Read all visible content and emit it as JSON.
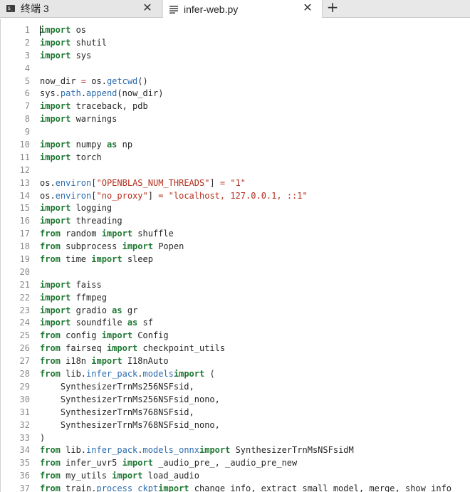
{
  "tabs": [
    {
      "label": "终端 3",
      "icon": "terminal-icon",
      "close": "✕"
    },
    {
      "label": "infer-web.py",
      "icon": "document-icon",
      "close": "✕"
    }
  ],
  "new_tab": "+",
  "colors": {
    "keyword": "#1e7832",
    "function": "#2b6cb0",
    "string": "#b5301e",
    "text": "#262626",
    "line_number": "#8a8a8a"
  },
  "code_lines": [
    {
      "n": "1",
      "tokens": [
        [
          "kw",
          "import"
        ],
        [
          "",
          "os"
        ]
      ]
    },
    {
      "n": "2",
      "tokens": [
        [
          "kw",
          "import"
        ],
        [
          "",
          "shutil"
        ]
      ]
    },
    {
      "n": "3",
      "tokens": [
        [
          "kw",
          "import"
        ],
        [
          "",
          "sys"
        ]
      ]
    },
    {
      "n": "4",
      "tokens": []
    },
    {
      "n": "5",
      "tokens": [
        [
          "",
          "now_dir "
        ],
        [
          "op",
          "="
        ],
        [
          "",
          "os."
        ],
        [
          "fn",
          "getcwd"
        ],
        [
          "",
          "()"
        ]
      ]
    },
    {
      "n": "6",
      "tokens": [
        [
          "",
          "sys."
        ],
        [
          "fn",
          "path"
        ],
        [
          "",
          "."
        ],
        [
          "fn",
          "append"
        ],
        [
          "",
          "(now_dir)"
        ]
      ]
    },
    {
      "n": "7",
      "tokens": [
        [
          "kw",
          "import"
        ],
        [
          "",
          "traceback, pdb"
        ]
      ]
    },
    {
      "n": "8",
      "tokens": [
        [
          "kw",
          "import"
        ],
        [
          "",
          "warnings"
        ]
      ]
    },
    {
      "n": "9",
      "tokens": []
    },
    {
      "n": "10",
      "tokens": [
        [
          "kw",
          "import"
        ],
        [
          "",
          "numpy "
        ],
        [
          "kw",
          "as"
        ],
        [
          "",
          "np"
        ]
      ]
    },
    {
      "n": "11",
      "tokens": [
        [
          "kw",
          "import"
        ],
        [
          "",
          "torch"
        ]
      ]
    },
    {
      "n": "12",
      "tokens": []
    },
    {
      "n": "13",
      "tokens": [
        [
          "",
          "os."
        ],
        [
          "fn",
          "environ"
        ],
        [
          "",
          "["
        ],
        [
          "st",
          "\"OPENBLAS_NUM_THREADS\""
        ],
        [
          "",
          "] "
        ],
        [
          "op",
          "="
        ],
        [
          "st",
          "\"1\""
        ]
      ]
    },
    {
      "n": "14",
      "tokens": [
        [
          "",
          "os."
        ],
        [
          "fn",
          "environ"
        ],
        [
          "",
          "["
        ],
        [
          "st",
          "\"no_proxy\""
        ],
        [
          "",
          "] "
        ],
        [
          "op",
          "="
        ],
        [
          "st",
          "\"localhost, 127.0.0.1, ::1\""
        ]
      ]
    },
    {
      "n": "15",
      "tokens": [
        [
          "kw",
          "import"
        ],
        [
          "",
          "logging"
        ]
      ]
    },
    {
      "n": "16",
      "tokens": [
        [
          "kw",
          "import"
        ],
        [
          "",
          "threading"
        ]
      ]
    },
    {
      "n": "17",
      "tokens": [
        [
          "kw",
          "from"
        ],
        [
          "",
          "random "
        ],
        [
          "kw",
          "import"
        ],
        [
          "",
          "shuffle"
        ]
      ]
    },
    {
      "n": "18",
      "tokens": [
        [
          "kw",
          "from"
        ],
        [
          "",
          "subprocess "
        ],
        [
          "kw",
          "import"
        ],
        [
          "",
          "Popen"
        ]
      ]
    },
    {
      "n": "19",
      "tokens": [
        [
          "kw",
          "from"
        ],
        [
          "",
          "time "
        ],
        [
          "kw",
          "import"
        ],
        [
          "",
          "sleep"
        ]
      ]
    },
    {
      "n": "20",
      "tokens": []
    },
    {
      "n": "21",
      "tokens": [
        [
          "kw",
          "import"
        ],
        [
          "",
          "faiss"
        ]
      ]
    },
    {
      "n": "22",
      "tokens": [
        [
          "kw",
          "import"
        ],
        [
          "",
          "ffmpeg"
        ]
      ]
    },
    {
      "n": "23",
      "tokens": [
        [
          "kw",
          "import"
        ],
        [
          "",
          "gradio "
        ],
        [
          "kw",
          "as"
        ],
        [
          "",
          "gr"
        ]
      ]
    },
    {
      "n": "24",
      "tokens": [
        [
          "kw",
          "import"
        ],
        [
          "",
          "soundfile "
        ],
        [
          "kw",
          "as"
        ],
        [
          "",
          "sf"
        ]
      ]
    },
    {
      "n": "25",
      "tokens": [
        [
          "kw",
          "from"
        ],
        [
          "",
          "config "
        ],
        [
          "kw",
          "import"
        ],
        [
          "",
          "Config"
        ]
      ]
    },
    {
      "n": "26",
      "tokens": [
        [
          "kw",
          "from"
        ],
        [
          "",
          "fairseq "
        ],
        [
          "kw",
          "import"
        ],
        [
          "",
          "checkpoint_utils"
        ]
      ]
    },
    {
      "n": "27",
      "tokens": [
        [
          "kw",
          "from"
        ],
        [
          "",
          "i18n "
        ],
        [
          "kw",
          "import"
        ],
        [
          "",
          "I18nAuto"
        ]
      ]
    },
    {
      "n": "28",
      "tokens": [
        [
          "kw",
          "from"
        ],
        [
          "",
          "lib."
        ],
        [
          "fn",
          "infer_pack"
        ],
        [
          "",
          "."
        ],
        [
          "fn",
          "models"
        ],
        [
          "kw",
          "import"
        ],
        [
          "",
          "("
        ]
      ]
    },
    {
      "n": "29",
      "tokens": [
        [
          "",
          "    SynthesizerTrnMs256NSFsid,"
        ]
      ]
    },
    {
      "n": "30",
      "tokens": [
        [
          "",
          "    SynthesizerTrnMs256NSFsid_nono,"
        ]
      ]
    },
    {
      "n": "31",
      "tokens": [
        [
          "",
          "    SynthesizerTrnMs768NSFsid,"
        ]
      ]
    },
    {
      "n": "32",
      "tokens": [
        [
          "",
          "    SynthesizerTrnMs768NSFsid_nono,"
        ]
      ]
    },
    {
      "n": "33",
      "tokens": [
        [
          "",
          ")"
        ]
      ]
    },
    {
      "n": "34",
      "tokens": [
        [
          "kw",
          "from"
        ],
        [
          "",
          "lib."
        ],
        [
          "fn",
          "infer_pack"
        ],
        [
          "",
          "."
        ],
        [
          "fn",
          "models_onnx"
        ],
        [
          "kw",
          "import"
        ],
        [
          "",
          "SynthesizerTrnMsNSFsidM"
        ]
      ]
    },
    {
      "n": "35",
      "tokens": [
        [
          "kw",
          "from"
        ],
        [
          "",
          "infer_uvr5 "
        ],
        [
          "kw",
          "import"
        ],
        [
          "",
          "_audio_pre_, _audio_pre_new"
        ]
      ]
    },
    {
      "n": "36",
      "tokens": [
        [
          "kw",
          "from"
        ],
        [
          "",
          "my_utils "
        ],
        [
          "kw",
          "import"
        ],
        [
          "",
          "load_audio"
        ]
      ]
    },
    {
      "n": "37",
      "tokens": [
        [
          "kw",
          "from"
        ],
        [
          "",
          "train."
        ],
        [
          "fn",
          "process_ckpt"
        ],
        [
          "kw",
          "import"
        ],
        [
          "",
          "change_info, extract_small_model, merge, show_info"
        ]
      ]
    }
  ]
}
